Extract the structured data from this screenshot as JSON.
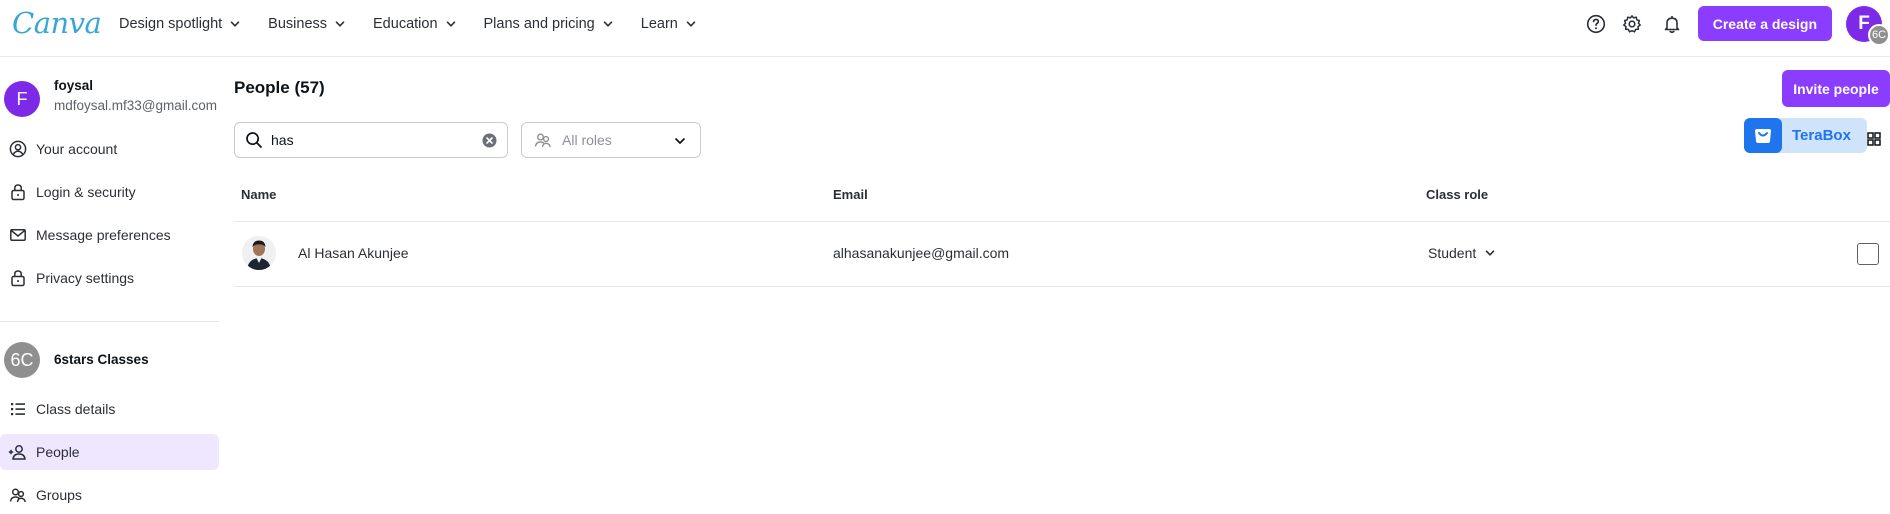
{
  "app": {
    "logo_text": "Canva",
    "nav": [
      {
        "label": "Design spotlight"
      },
      {
        "label": "Business"
      },
      {
        "label": "Education"
      },
      {
        "label": "Plans and pricing"
      },
      {
        "label": "Learn"
      }
    ],
    "create_button": "Create a design",
    "avatar_initial": "F",
    "avatar_team_initials": "6C",
    "icons": [
      "help-icon",
      "settings-icon",
      "notification-bell-icon"
    ]
  },
  "sidebar": {
    "user": {
      "initial": "F",
      "name": "foysal",
      "email": "mdfoysal.mf33@gmail.com"
    },
    "account_items": [
      {
        "label": "Your account",
        "icon": "user-circle-icon"
      },
      {
        "label": "Login & security",
        "icon": "lock-icon"
      },
      {
        "label": "Message preferences",
        "icon": "mail-icon"
      },
      {
        "label": "Privacy settings",
        "icon": "lock-icon"
      }
    ],
    "team": {
      "initials": "6C",
      "name": "6stars Classes"
    },
    "team_items": [
      {
        "label": "Class details",
        "icon": "list-icon",
        "active": false
      },
      {
        "label": "People",
        "icon": "people-add-icon",
        "active": true
      },
      {
        "label": "Groups",
        "icon": "groups-icon",
        "active": false
      }
    ]
  },
  "main": {
    "title": "People (57)",
    "invite_button": "Invite people",
    "search": {
      "value": "has",
      "placeholder": ""
    },
    "roles_filter": {
      "label": "All roles"
    },
    "terabox": {
      "label": "TeraBox"
    },
    "table": {
      "columns": [
        "Name",
        "Email",
        "Class role"
      ],
      "rows": [
        {
          "name": "Al Hasan Akunjee",
          "email": "alhasanakunjee@gmail.com",
          "role": "Student",
          "checked": false
        }
      ]
    }
  },
  "colors": {
    "brand_purple": "#8b3dff",
    "active_bg": "#efe6ff",
    "terabox_blue": "#1e75ee"
  }
}
